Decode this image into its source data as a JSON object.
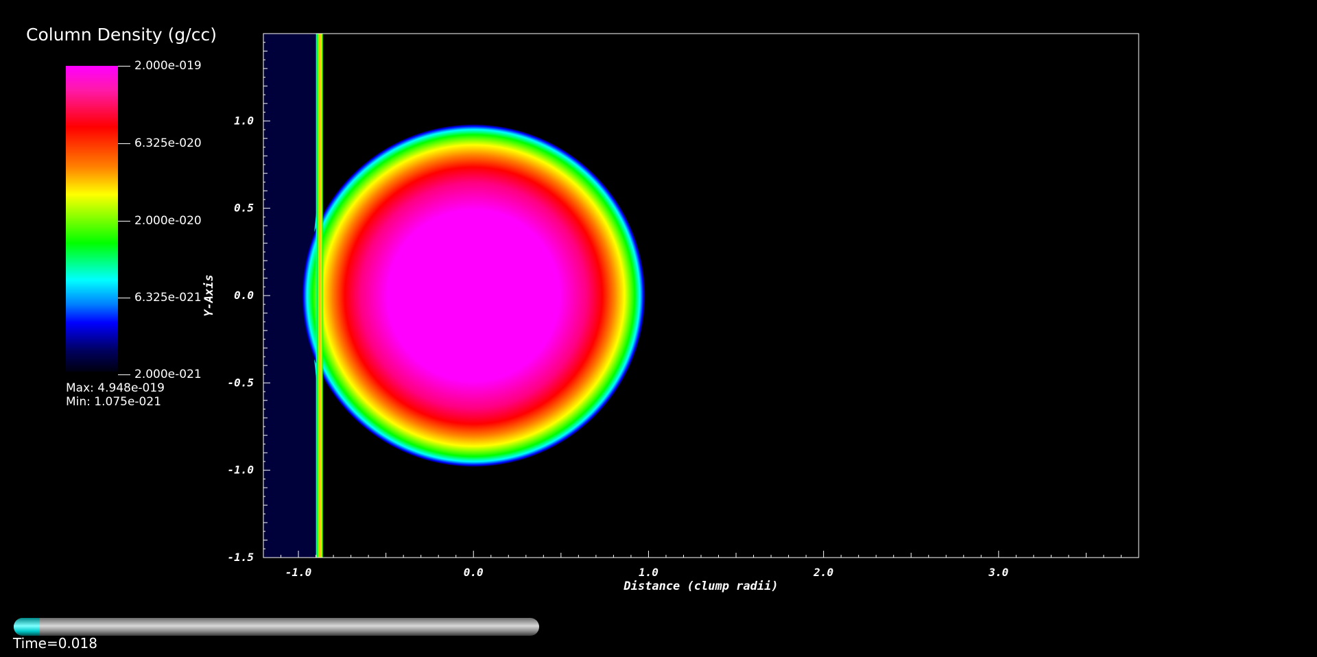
{
  "legend": {
    "title": "Column Density (g/cc)",
    "ticks": [
      "2.000e-019",
      "6.325e-020",
      "2.000e-020",
      "6.325e-021",
      "2.000e-021"
    ],
    "max_label": "Max:  4.948e-019",
    "min_label": "Min:  1.075e-021",
    "colormap": [
      "#ff00ff",
      "#ff0000",
      "#ff8000",
      "#ffff00",
      "#00ff00",
      "#00ffff",
      "#0000ff",
      "#000010"
    ]
  },
  "chart_data": {
    "type": "heatmap",
    "xlabel": "Distance (clump radii)",
    "ylabel": "Y-Axis",
    "xlim": [
      -1.2,
      3.8
    ],
    "ylim": [
      -1.5,
      1.5
    ],
    "x_ticks": [
      "-1.0",
      "0.0",
      "1.0",
      "2.0",
      "3.0"
    ],
    "x_tick_values": [
      -1.0,
      0.0,
      1.0,
      2.0,
      3.0
    ],
    "y_ticks": [
      "1.0",
      "0.5",
      "0.0",
      "-0.5",
      "-1.0",
      "-1.5"
    ],
    "y_tick_values": [
      1.0,
      0.5,
      0.0,
      -0.5,
      -1.0,
      -1.5
    ],
    "clump": {
      "center": [
        0.0,
        0.0
      ],
      "radius": 0.98
    },
    "shock_x": -0.88,
    "post_shock_region": [
      -1.2,
      -0.9
    ],
    "background_color": "#000000",
    "region_color": "#00003a"
  },
  "time_slider": {
    "label": "Time=0.018",
    "progress": 0.05
  }
}
